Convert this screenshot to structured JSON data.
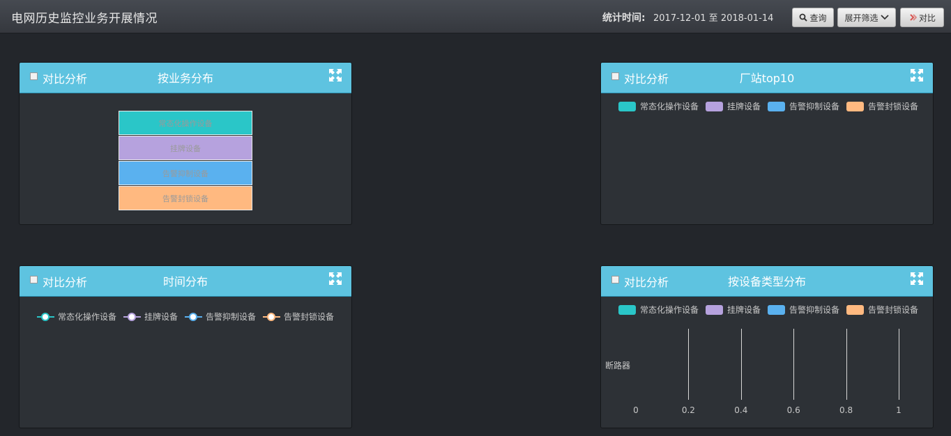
{
  "header": {
    "title": "电网历史监控业务开展情况",
    "stat_label": "统计时间:",
    "date_range": "2017-12-01 至 2018-01-14",
    "query_label": "查询",
    "filter_label": "展开筛选",
    "compare_label": "对比"
  },
  "colors": {
    "cyan": "#2ac6c8",
    "purple": "#b6a2de",
    "blue": "#5ab1ef",
    "orange": "#ffb980",
    "header_blue": "#5ec3e0"
  },
  "panels": {
    "business": {
      "compare_label": "对比分析",
      "title": "按业务分布",
      "funnel": [
        "常态化操作设备",
        "挂牌设备",
        "告警抑制设备",
        "告警封锁设备"
      ]
    },
    "station": {
      "compare_label": "对比分析",
      "title": "厂站top10",
      "legend": [
        "常态化操作设备",
        "挂牌设备",
        "告警抑制设备",
        "告警封锁设备"
      ]
    },
    "time": {
      "compare_label": "对比分析",
      "title": "时间分布",
      "legend": [
        "常态化操作设备",
        "挂牌设备",
        "告警抑制设备",
        "告警封锁设备"
      ]
    },
    "device": {
      "compare_label": "对比分析",
      "title": "按设备类型分布",
      "legend": [
        "常态化操作设备",
        "挂牌设备",
        "告警抑制设备",
        "告警封锁设备"
      ]
    }
  },
  "chart_data": {
    "type": "bar",
    "categories": [
      "断路器"
    ],
    "series": [
      {
        "name": "常态化操作设备",
        "values": [
          0
        ]
      },
      {
        "name": "挂牌设备",
        "values": [
          0
        ]
      },
      {
        "name": "告警抑制设备",
        "values": [
          0
        ]
      },
      {
        "name": "告警封锁设备",
        "values": [
          0
        ]
      }
    ],
    "x_ticks": [
      "0",
      "0.2",
      "0.4",
      "0.6",
      "0.8",
      "1"
    ],
    "xlim": [
      0,
      1
    ],
    "orientation": "horizontal",
    "grid": true,
    "legend_position": "top"
  }
}
